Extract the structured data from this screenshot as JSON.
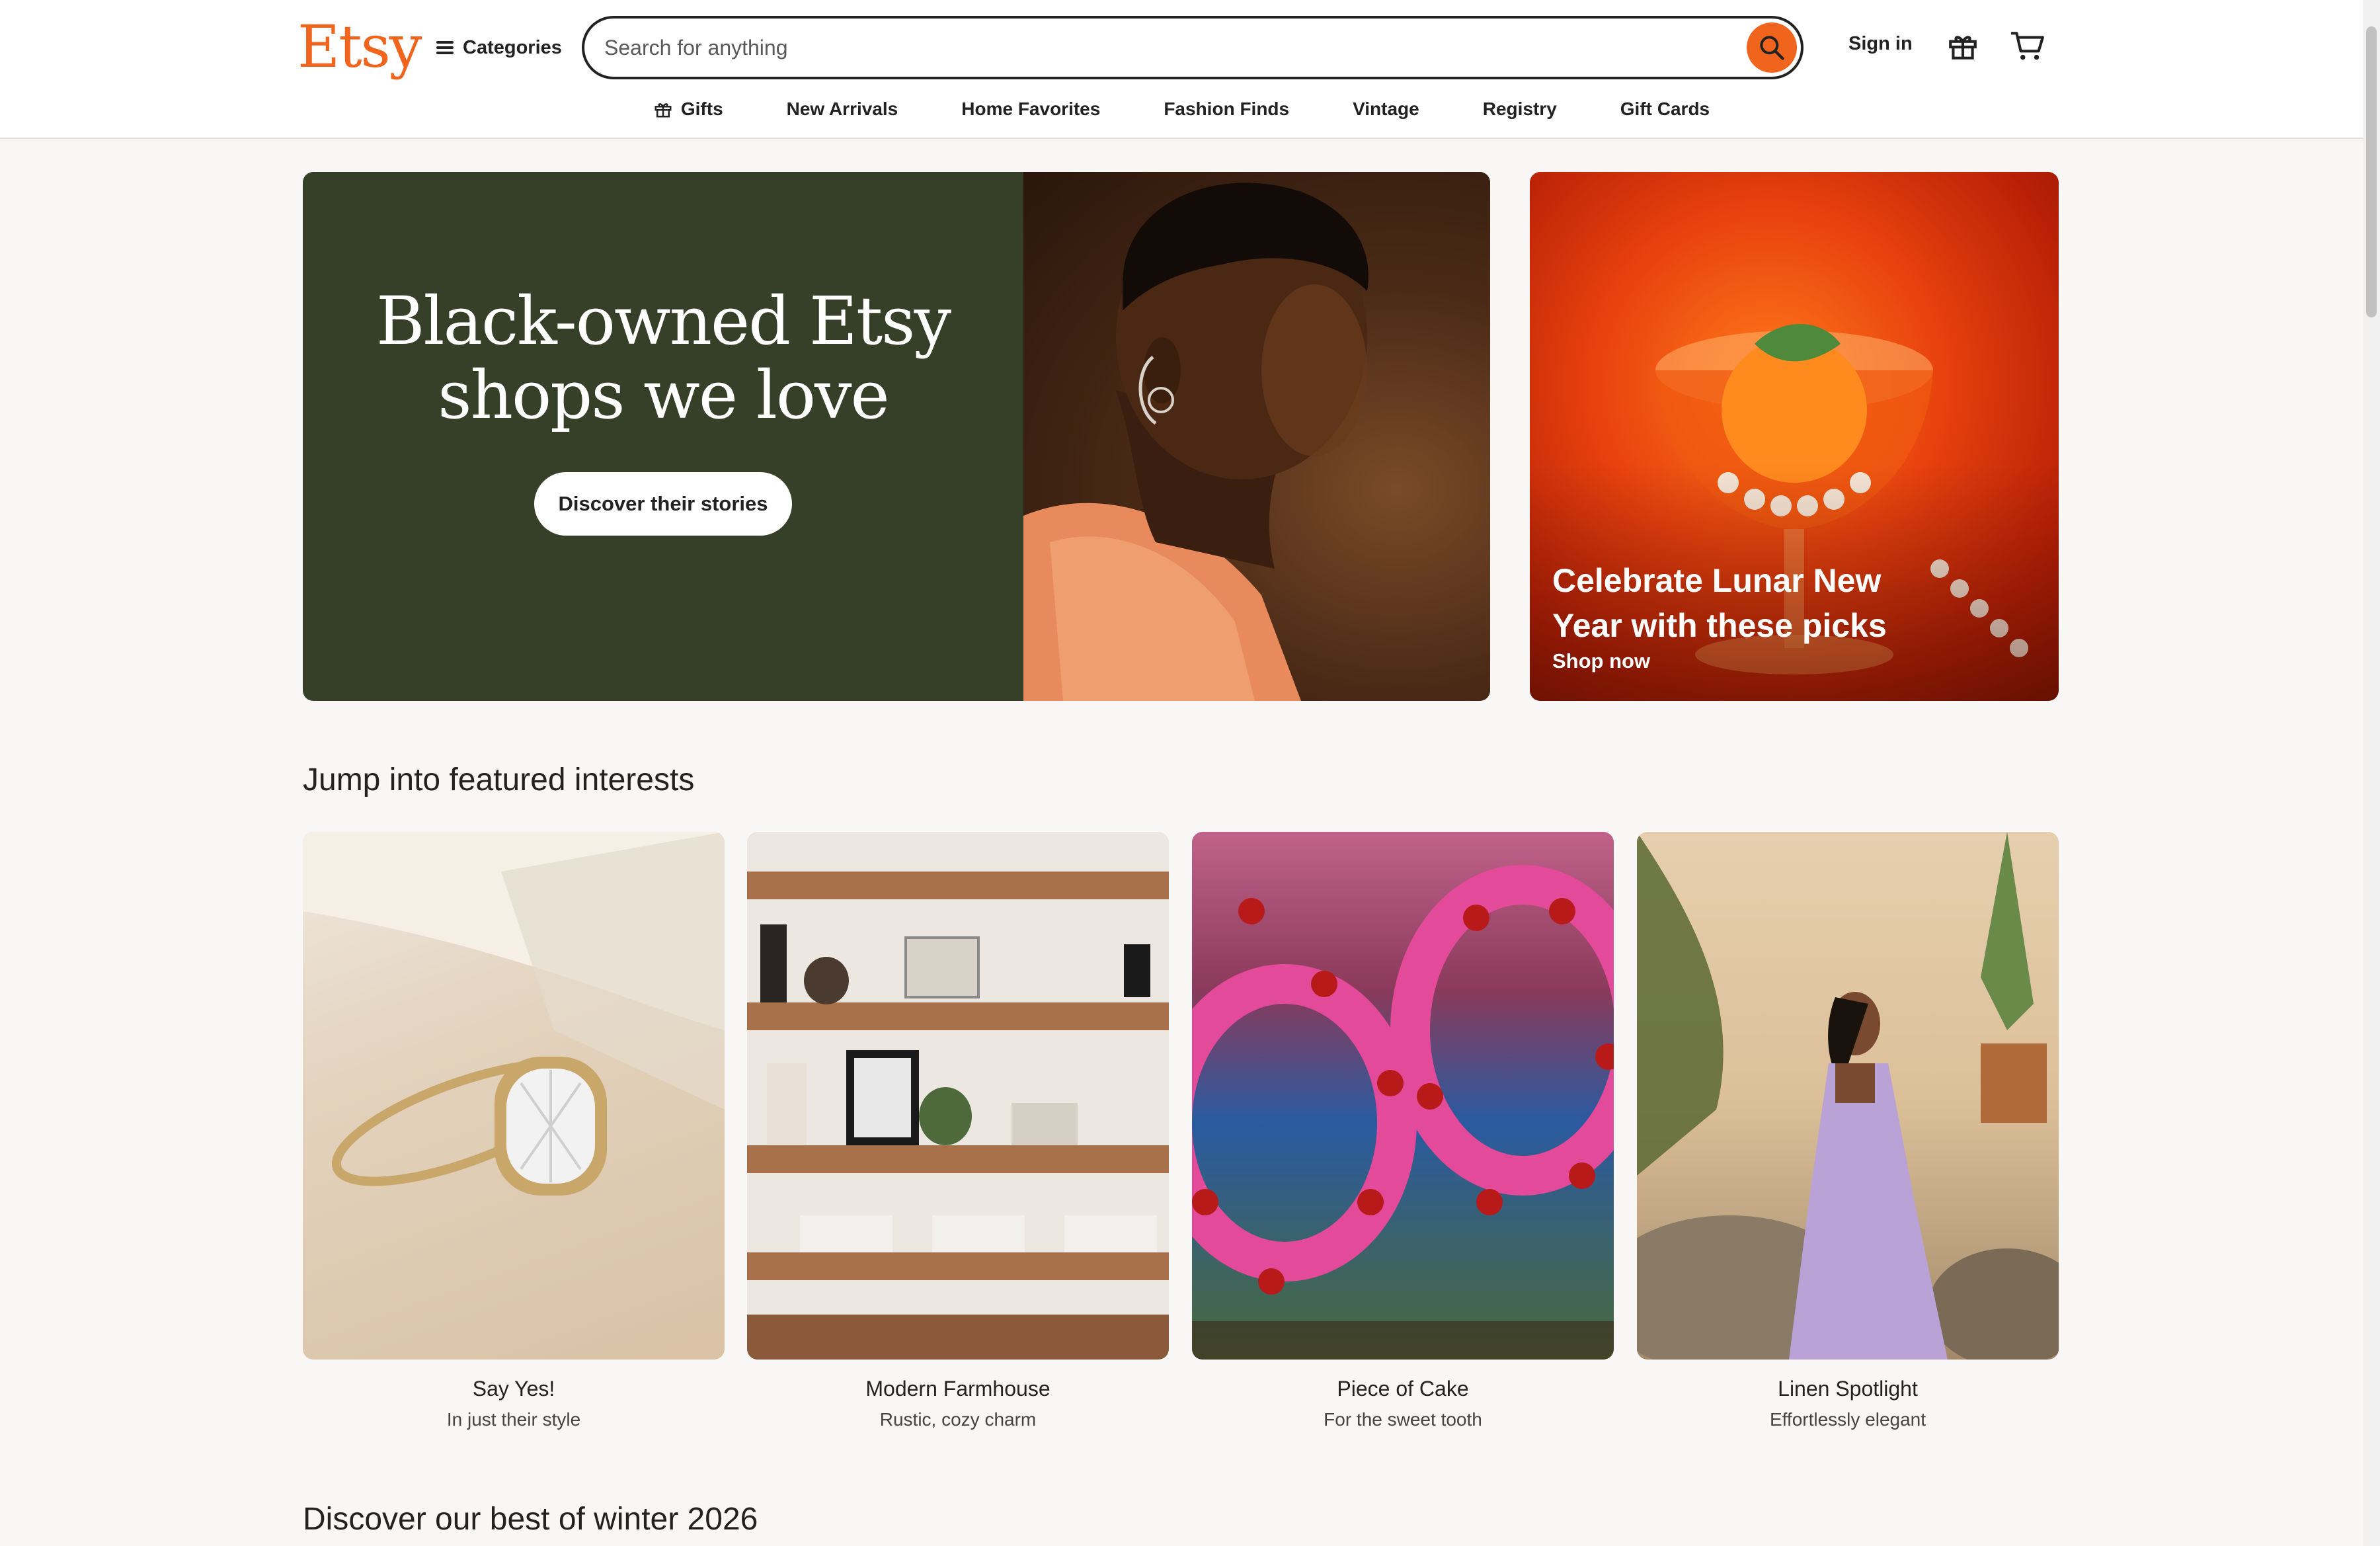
{
  "header": {
    "logo": "Etsy",
    "categories_label": "Categories",
    "search_placeholder": "Search for anything",
    "search_value": "",
    "signin_label": "Sign in"
  },
  "nav": {
    "items": [
      {
        "label": "Gifts",
        "icon": "gift-icon"
      },
      {
        "label": "New Arrivals"
      },
      {
        "label": "Home Favorites"
      },
      {
        "label": "Fashion Finds"
      },
      {
        "label": "Vintage"
      },
      {
        "label": "Registry"
      },
      {
        "label": "Gift Cards"
      }
    ]
  },
  "hero": {
    "title_line1": "Black-owned Etsy",
    "title_line2": "shops we love",
    "button_label": "Discover their stories"
  },
  "promo": {
    "title_line1": "Celebrate Lunar New",
    "title_line2": "Year with these picks",
    "link_label": "Shop now"
  },
  "featured": {
    "heading": "Jump into featured interests",
    "cards": [
      {
        "title": "Say Yes!",
        "subtitle": "In just their style"
      },
      {
        "title": "Modern Farmhouse",
        "subtitle": "Rustic, cozy charm"
      },
      {
        "title": "Piece of Cake",
        "subtitle": "For the sweet tooth"
      },
      {
        "title": "Linen Spotlight",
        "subtitle": "Effortlessly elegant"
      }
    ]
  },
  "winter": {
    "heading": "Discover our best of winter 2026"
  },
  "colors": {
    "brand_orange": "#f1641e",
    "hero_green": "#363f28",
    "page_bg": "#f8f7f5"
  }
}
